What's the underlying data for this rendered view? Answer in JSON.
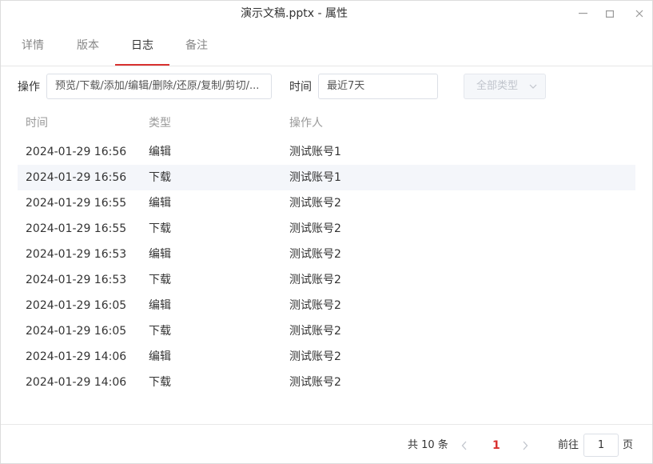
{
  "window": {
    "title": "演示文稿.pptx - 属性",
    "minimize_icon": "minimize-icon",
    "maximize_icon": "maximize-icon",
    "close_icon": "close-icon"
  },
  "tabs": [
    {
      "label": "详情",
      "active": false
    },
    {
      "label": "版本",
      "active": false
    },
    {
      "label": "日志",
      "active": true
    },
    {
      "label": "备注",
      "active": false
    }
  ],
  "filters": {
    "operation_label": "操作",
    "operation_value": "预览/下载/添加/编辑/删除/还原/复制/剪切/...",
    "time_label": "时间",
    "time_value": "最近7天",
    "type_value": "全部类型",
    "type_icon": "chevron-down-icon"
  },
  "table": {
    "headers": [
      "时间",
      "类型",
      "操作人"
    ],
    "rows": [
      {
        "time": "2024-01-29 16:56",
        "type": "编辑",
        "user": "测试账号1"
      },
      {
        "time": "2024-01-29 16:56",
        "type": "下载",
        "user": "测试账号1"
      },
      {
        "time": "2024-01-29 16:55",
        "type": "编辑",
        "user": "测试账号2"
      },
      {
        "time": "2024-01-29 16:55",
        "type": "下载",
        "user": "测试账号2"
      },
      {
        "time": "2024-01-29 16:53",
        "type": "编辑",
        "user": "测试账号2"
      },
      {
        "time": "2024-01-29 16:53",
        "type": "下载",
        "user": "测试账号2"
      },
      {
        "time": "2024-01-29 16:05",
        "type": "编辑",
        "user": "测试账号2"
      },
      {
        "time": "2024-01-29 16:05",
        "type": "下载",
        "user": "测试账号2"
      },
      {
        "time": "2024-01-29 14:06",
        "type": "编辑",
        "user": "测试账号2"
      },
      {
        "time": "2024-01-29 14:06",
        "type": "下载",
        "user": "测试账号2"
      }
    ]
  },
  "pagination": {
    "total_text": "共 10 条",
    "current_page": "1",
    "goto_label": "前往",
    "goto_value": "1",
    "goto_suffix": "页"
  },
  "colors": {
    "accent": "#d9312f",
    "row_highlight": "#f4f6fa"
  }
}
